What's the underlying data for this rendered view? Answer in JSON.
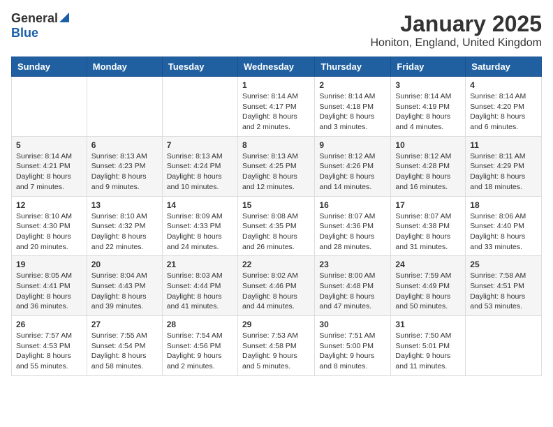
{
  "logo": {
    "general": "General",
    "blue": "Blue"
  },
  "header": {
    "month": "January 2025",
    "location": "Honiton, England, United Kingdom"
  },
  "weekdays": [
    "Sunday",
    "Monday",
    "Tuesday",
    "Wednesday",
    "Thursday",
    "Friday",
    "Saturday"
  ],
  "weeks": [
    [
      {
        "day": "",
        "sunrise": "",
        "sunset": "",
        "daylight": ""
      },
      {
        "day": "",
        "sunrise": "",
        "sunset": "",
        "daylight": ""
      },
      {
        "day": "",
        "sunrise": "",
        "sunset": "",
        "daylight": ""
      },
      {
        "day": "1",
        "sunrise": "Sunrise: 8:14 AM",
        "sunset": "Sunset: 4:17 PM",
        "daylight": "Daylight: 8 hours and 2 minutes."
      },
      {
        "day": "2",
        "sunrise": "Sunrise: 8:14 AM",
        "sunset": "Sunset: 4:18 PM",
        "daylight": "Daylight: 8 hours and 3 minutes."
      },
      {
        "day": "3",
        "sunrise": "Sunrise: 8:14 AM",
        "sunset": "Sunset: 4:19 PM",
        "daylight": "Daylight: 8 hours and 4 minutes."
      },
      {
        "day": "4",
        "sunrise": "Sunrise: 8:14 AM",
        "sunset": "Sunset: 4:20 PM",
        "daylight": "Daylight: 8 hours and 6 minutes."
      }
    ],
    [
      {
        "day": "5",
        "sunrise": "Sunrise: 8:14 AM",
        "sunset": "Sunset: 4:21 PM",
        "daylight": "Daylight: 8 hours and 7 minutes."
      },
      {
        "day": "6",
        "sunrise": "Sunrise: 8:13 AM",
        "sunset": "Sunset: 4:23 PM",
        "daylight": "Daylight: 8 hours and 9 minutes."
      },
      {
        "day": "7",
        "sunrise": "Sunrise: 8:13 AM",
        "sunset": "Sunset: 4:24 PM",
        "daylight": "Daylight: 8 hours and 10 minutes."
      },
      {
        "day": "8",
        "sunrise": "Sunrise: 8:13 AM",
        "sunset": "Sunset: 4:25 PM",
        "daylight": "Daylight: 8 hours and 12 minutes."
      },
      {
        "day": "9",
        "sunrise": "Sunrise: 8:12 AM",
        "sunset": "Sunset: 4:26 PM",
        "daylight": "Daylight: 8 hours and 14 minutes."
      },
      {
        "day": "10",
        "sunrise": "Sunrise: 8:12 AM",
        "sunset": "Sunset: 4:28 PM",
        "daylight": "Daylight: 8 hours and 16 minutes."
      },
      {
        "day": "11",
        "sunrise": "Sunrise: 8:11 AM",
        "sunset": "Sunset: 4:29 PM",
        "daylight": "Daylight: 8 hours and 18 minutes."
      }
    ],
    [
      {
        "day": "12",
        "sunrise": "Sunrise: 8:10 AM",
        "sunset": "Sunset: 4:30 PM",
        "daylight": "Daylight: 8 hours and 20 minutes."
      },
      {
        "day": "13",
        "sunrise": "Sunrise: 8:10 AM",
        "sunset": "Sunset: 4:32 PM",
        "daylight": "Daylight: 8 hours and 22 minutes."
      },
      {
        "day": "14",
        "sunrise": "Sunrise: 8:09 AM",
        "sunset": "Sunset: 4:33 PM",
        "daylight": "Daylight: 8 hours and 24 minutes."
      },
      {
        "day": "15",
        "sunrise": "Sunrise: 8:08 AM",
        "sunset": "Sunset: 4:35 PM",
        "daylight": "Daylight: 8 hours and 26 minutes."
      },
      {
        "day": "16",
        "sunrise": "Sunrise: 8:07 AM",
        "sunset": "Sunset: 4:36 PM",
        "daylight": "Daylight: 8 hours and 28 minutes."
      },
      {
        "day": "17",
        "sunrise": "Sunrise: 8:07 AM",
        "sunset": "Sunset: 4:38 PM",
        "daylight": "Daylight: 8 hours and 31 minutes."
      },
      {
        "day": "18",
        "sunrise": "Sunrise: 8:06 AM",
        "sunset": "Sunset: 4:40 PM",
        "daylight": "Daylight: 8 hours and 33 minutes."
      }
    ],
    [
      {
        "day": "19",
        "sunrise": "Sunrise: 8:05 AM",
        "sunset": "Sunset: 4:41 PM",
        "daylight": "Daylight: 8 hours and 36 minutes."
      },
      {
        "day": "20",
        "sunrise": "Sunrise: 8:04 AM",
        "sunset": "Sunset: 4:43 PM",
        "daylight": "Daylight: 8 hours and 39 minutes."
      },
      {
        "day": "21",
        "sunrise": "Sunrise: 8:03 AM",
        "sunset": "Sunset: 4:44 PM",
        "daylight": "Daylight: 8 hours and 41 minutes."
      },
      {
        "day": "22",
        "sunrise": "Sunrise: 8:02 AM",
        "sunset": "Sunset: 4:46 PM",
        "daylight": "Daylight: 8 hours and 44 minutes."
      },
      {
        "day": "23",
        "sunrise": "Sunrise: 8:00 AM",
        "sunset": "Sunset: 4:48 PM",
        "daylight": "Daylight: 8 hours and 47 minutes."
      },
      {
        "day": "24",
        "sunrise": "Sunrise: 7:59 AM",
        "sunset": "Sunset: 4:49 PM",
        "daylight": "Daylight: 8 hours and 50 minutes."
      },
      {
        "day": "25",
        "sunrise": "Sunrise: 7:58 AM",
        "sunset": "Sunset: 4:51 PM",
        "daylight": "Daylight: 8 hours and 53 minutes."
      }
    ],
    [
      {
        "day": "26",
        "sunrise": "Sunrise: 7:57 AM",
        "sunset": "Sunset: 4:53 PM",
        "daylight": "Daylight: 8 hours and 55 minutes."
      },
      {
        "day": "27",
        "sunrise": "Sunrise: 7:55 AM",
        "sunset": "Sunset: 4:54 PM",
        "daylight": "Daylight: 8 hours and 58 minutes."
      },
      {
        "day": "28",
        "sunrise": "Sunrise: 7:54 AM",
        "sunset": "Sunset: 4:56 PM",
        "daylight": "Daylight: 9 hours and 2 minutes."
      },
      {
        "day": "29",
        "sunrise": "Sunrise: 7:53 AM",
        "sunset": "Sunset: 4:58 PM",
        "daylight": "Daylight: 9 hours and 5 minutes."
      },
      {
        "day": "30",
        "sunrise": "Sunrise: 7:51 AM",
        "sunset": "Sunset: 5:00 PM",
        "daylight": "Daylight: 9 hours and 8 minutes."
      },
      {
        "day": "31",
        "sunrise": "Sunrise: 7:50 AM",
        "sunset": "Sunset: 5:01 PM",
        "daylight": "Daylight: 9 hours and 11 minutes."
      },
      {
        "day": "",
        "sunrise": "",
        "sunset": "",
        "daylight": ""
      }
    ]
  ]
}
